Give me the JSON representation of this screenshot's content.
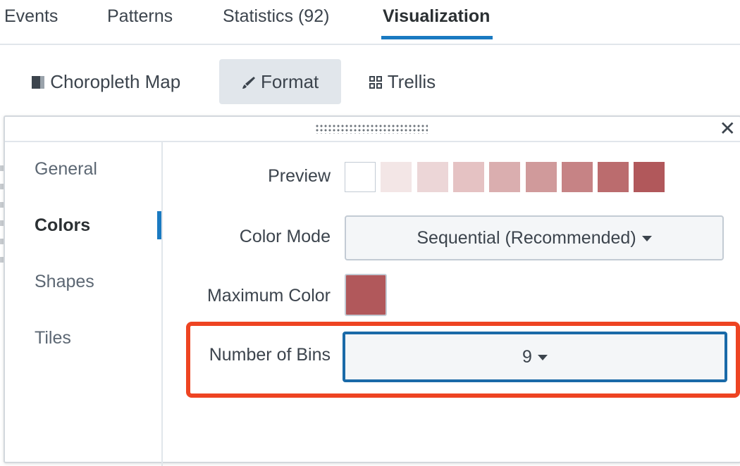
{
  "top_tabs": [
    {
      "label": "Events"
    },
    {
      "label": "Patterns"
    },
    {
      "label": "Statistics (92)"
    },
    {
      "label": "Visualization"
    }
  ],
  "toolbar": {
    "viz_type_label": "Choropleth Map",
    "format_label": "Format",
    "trellis_label": "Trellis"
  },
  "panel": {
    "close_glyph": "✕",
    "sidebar": [
      {
        "label": "General"
      },
      {
        "label": "Colors"
      },
      {
        "label": "Shapes"
      },
      {
        "label": "Tiles"
      }
    ],
    "form": {
      "preview_label": "Preview",
      "preview_colors": [
        "#ffffff",
        "#f3e6e6",
        "#ecd6d7",
        "#e5c2c3",
        "#daaeaf",
        "#d09a9b",
        "#c68385",
        "#bb6c6e",
        "#b1585b"
      ],
      "color_mode_label": "Color Mode",
      "color_mode_value": "Sequential (Recommended)",
      "max_color_label": "Maximum Color",
      "max_color_value": "#b1585b",
      "bins_label": "Number of Bins",
      "bins_value": "9"
    }
  },
  "colors": {
    "accent": "#1a7ac1",
    "highlight": "#ee4422"
  }
}
